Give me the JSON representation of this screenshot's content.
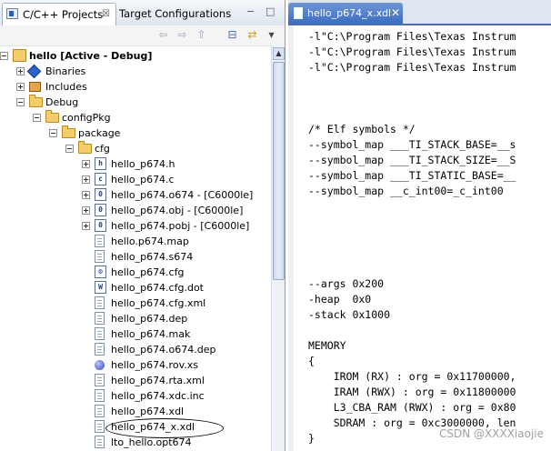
{
  "left_panel": {
    "tabs": [
      {
        "label": "C/C++ Projects",
        "close": "☒"
      },
      {
        "label": "Target Configurations"
      }
    ],
    "window_buttons": {
      "minimize": "−",
      "maximize": "□"
    },
    "tree": [
      {
        "label": "hello  [Active - Debug]",
        "icon": "project-icon",
        "depth": 0,
        "expander": "minus",
        "bold": true
      },
      {
        "label": "Binaries",
        "icon": "binaries-icon",
        "depth": 1,
        "expander": "plus"
      },
      {
        "label": "Includes",
        "icon": "includes-icon",
        "depth": 1,
        "expander": "plus"
      },
      {
        "label": "Debug",
        "icon": "folder-icon",
        "depth": 1,
        "expander": "minus"
      },
      {
        "label": "configPkg",
        "icon": "folder-icon",
        "depth": 2,
        "expander": "minus"
      },
      {
        "label": "package",
        "icon": "folder-icon",
        "depth": 3,
        "expander": "minus"
      },
      {
        "label": "cfg",
        "icon": "folder-icon",
        "depth": 4,
        "expander": "minus"
      },
      {
        "label": "hello_p674.h",
        "icon": "header-file-icon",
        "depth": 5,
        "expander": "plus",
        "glyph": "h"
      },
      {
        "label": "hello_p674.c",
        "icon": "c-file-icon",
        "depth": 5,
        "expander": "plus",
        "glyph": "c"
      },
      {
        "label": "hello_p674.o674 - [C6000le]",
        "icon": "object-file-icon",
        "depth": 5,
        "expander": "plus",
        "glyph": "010"
      },
      {
        "label": "hello_p674.obj - [C6000le]",
        "icon": "object-file-icon",
        "depth": 5,
        "expander": "plus",
        "glyph": "010"
      },
      {
        "label": "hello_p674.pobj - [C6000le]",
        "icon": "object-file-icon",
        "depth": 5,
        "expander": "plus",
        "glyph": "010"
      },
      {
        "label": "hello.p674.map",
        "icon": "file-icon",
        "depth": 5
      },
      {
        "label": "hello_p674.s674",
        "icon": "file-icon",
        "depth": 5
      },
      {
        "label": "hello_p674.cfg",
        "icon": "cfg-file-icon",
        "depth": 5
      },
      {
        "label": "hello_p674.cfg.dot",
        "icon": "word-file-icon",
        "depth": 5
      },
      {
        "label": "hello_p674.cfg.xml",
        "icon": "file-icon",
        "depth": 5
      },
      {
        "label": "hello_p674.dep",
        "icon": "file-icon",
        "depth": 5
      },
      {
        "label": "hello_p674.mak",
        "icon": "file-icon",
        "depth": 5
      },
      {
        "label": "hello_p674.o674.dep",
        "icon": "file-icon",
        "depth": 5
      },
      {
        "label": "hello_p674.rov.xs",
        "icon": "rov-file-icon",
        "depth": 5
      },
      {
        "label": "hello_p674.rta.xml",
        "icon": "file-icon",
        "depth": 5
      },
      {
        "label": "hello_p674.xdc.inc",
        "icon": "file-icon",
        "depth": 5
      },
      {
        "label": "hello_p674.xdl",
        "icon": "file-icon",
        "depth": 5
      },
      {
        "label": "hello_p674_x.xdl",
        "icon": "file-icon",
        "depth": 5,
        "highlighted": true
      },
      {
        "label": "lto_hello.opt674",
        "icon": "file-icon",
        "depth": 5
      }
    ]
  },
  "editor": {
    "tab_label": "hello_p674_x.xdl",
    "tab_close": "✕",
    "lines": [
      "-l\"C:\\Program Files\\Texas Instrum",
      "-l\"C:\\Program Files\\Texas Instrum",
      "-l\"C:\\Program Files\\Texas Instrum",
      "",
      "",
      "",
      "/* Elf symbols */",
      "--symbol_map ___TI_STACK_BASE=__s",
      "--symbol_map ___TI_STACK_SIZE=__S",
      "--symbol_map ___TI_STATIC_BASE=__",
      "--symbol_map __c_int00=_c_int00",
      "",
      "",
      "",
      "",
      "",
      "--args 0x200",
      "-heap  0x0",
      "-stack 0x1000",
      "",
      "MEMORY",
      "{",
      "    IROM (RX) : org = 0x11700000,",
      "    IRAM (RWX) : org = 0x11800000",
      "    L3_CBA_RAM (RWX) : org = 0x80",
      "    SDRAM : org = 0xc3000000, len",
      "}"
    ]
  },
  "watermark": "CSDN @XXXXiaojie"
}
